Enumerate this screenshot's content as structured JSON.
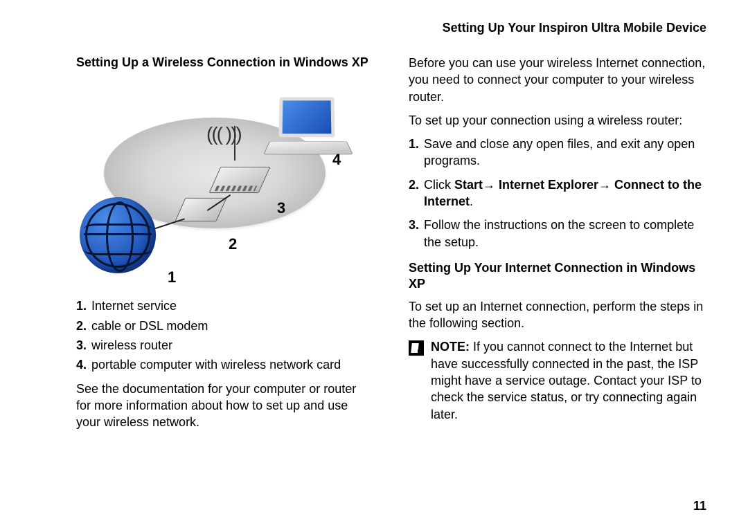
{
  "header": {
    "title": "Setting Up Your Inspiron Ultra Mobile Device"
  },
  "left": {
    "heading": "Setting Up a Wireless Connection in Windows XP",
    "diagram": {
      "labels": {
        "n1": "1",
        "n2": "2",
        "n3": "3",
        "n4": "4"
      },
      "waves": "((( )))"
    },
    "legend": [
      {
        "num": "1.",
        "text": "Internet service"
      },
      {
        "num": "2.",
        "text": "cable or DSL modem"
      },
      {
        "num": "3.",
        "text": "wireless router"
      },
      {
        "num": "4.",
        "text": "portable computer with wireless network card"
      }
    ],
    "footer": "See the documentation for your computer or router for more information about how to set up and use your wireless network."
  },
  "right": {
    "para1": "Before you can use your wireless Internet connection, you need to connect your computer to your wireless router.",
    "para2": "To set up your connection using a wireless router:",
    "steps": [
      {
        "num": "1.",
        "pre": "",
        "bold": "",
        "post": "Save and close any open files, and exit any open programs."
      },
      {
        "num": "2.",
        "pre": "Click ",
        "bold": "Start→ Internet Explorer→ Connect to the Internet",
        "post": "."
      },
      {
        "num": "3.",
        "pre": "",
        "bold": "",
        "post": "Follow the instructions on the screen  to complete the setup."
      }
    ],
    "heading2": "Setting Up Your Internet Connection in Windows XP",
    "para3": "To set up an Internet connection, perform the steps in the following section.",
    "note_label": "NOTE:",
    "note_text": " If you cannot connect to the Internet but have successfully connected in the past, the ISP might have a service outage. Contact your ISP to check the service status, or try connecting again later."
  },
  "page_number": "11"
}
